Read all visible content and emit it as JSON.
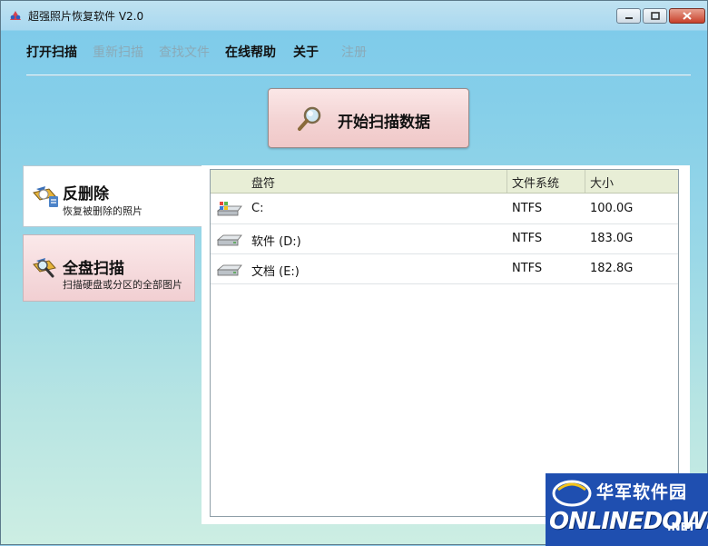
{
  "window": {
    "title": "超强照片恢复软件 V2.0"
  },
  "menu": [
    "打开扫描",
    "重新扫描",
    "查找文件",
    "在线帮助",
    "关于",
    "注册"
  ],
  "scan_button": {
    "label": "开始扫描数据",
    "icon": "magnifier-icon"
  },
  "side_tabs": [
    {
      "title": "反删除",
      "desc": "恢复被删除的照片",
      "icon": "undelete-icon",
      "selected": true
    },
    {
      "title": "全盘扫描",
      "desc": "扫描硬盘或分区的全部图片",
      "icon": "full-scan-icon",
      "selected": false
    }
  ],
  "table": {
    "headers": [
      "盘符",
      "文件系统",
      "大小"
    ],
    "rows": [
      {
        "drive": "C:",
        "fs": "NTFS",
        "size": "100.0G",
        "icon": "system-drive-icon"
      },
      {
        "drive": "软件 (D:)",
        "fs": "NTFS",
        "size": "183.0G",
        "icon": "hard-drive-icon"
      },
      {
        "drive": "文档 (E:)",
        "fs": "NTFS",
        "size": "182.8G",
        "icon": "hard-drive-icon"
      }
    ]
  },
  "watermark": {
    "cn": "华军软件园",
    "en": "ONLINEDOWN",
    "suffix": ".NET"
  },
  "colors": {
    "accent_pink": "#f3d3d3",
    "header_bg": "#e8eed6",
    "watermark_bg": "#1f4fb0"
  }
}
